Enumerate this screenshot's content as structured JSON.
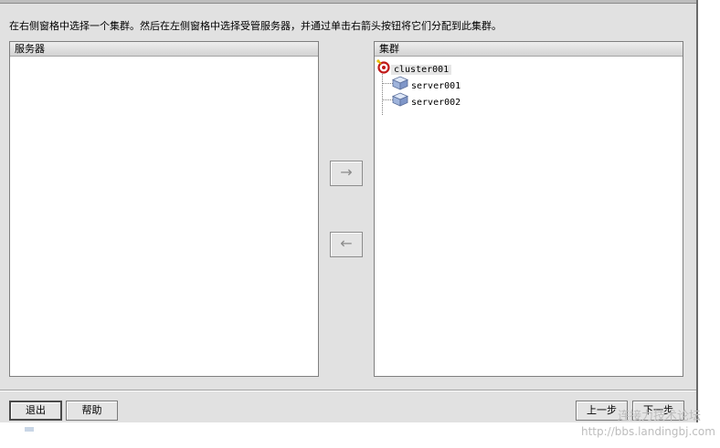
{
  "instruction": "在右侧窗格中选择一个集群。然后在左侧窗格中选择受管服务器，并通过单击右箭头按钮将它们分配到此集群。",
  "servers_panel": {
    "header": "服务器",
    "items": []
  },
  "cluster_panel": {
    "header": "集群",
    "root": {
      "label": "cluster001",
      "icon": "cluster-icon"
    },
    "children": [
      {
        "label": "server001",
        "icon": "server-icon"
      },
      {
        "label": "server002",
        "icon": "server-icon"
      }
    ]
  },
  "arrows": {
    "add": "→",
    "remove": "←"
  },
  "buttons": {
    "exit": "退出",
    "help": "帮助",
    "prev": "上一步",
    "next": "下一步"
  },
  "watermark": {
    "line1": "连接力技术论坛",
    "line2": "http://bbs.landingbj.com"
  }
}
